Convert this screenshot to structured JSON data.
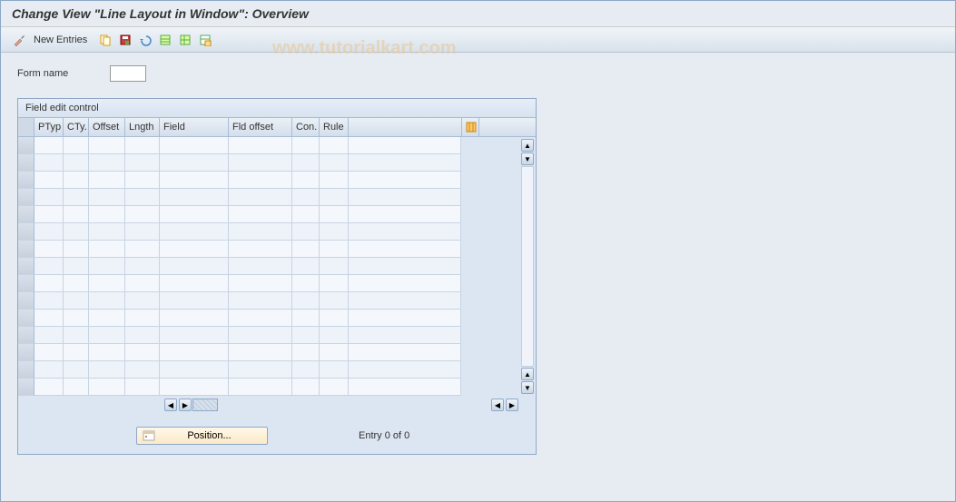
{
  "title": "Change View \"Line Layout in Window\": Overview",
  "toolbar": {
    "new_entries": "New Entries"
  },
  "watermark": "www.tutorialkart.com",
  "form": {
    "name_label": "Form name",
    "name_value": ""
  },
  "panel": {
    "title": "Field edit control",
    "columns": {
      "ptyp": "PTyp",
      "cty": "CTy.",
      "offset": "Offset",
      "lngth": "Lngth",
      "field": "Field",
      "fld_offset": "Fld offset",
      "con": "Con.",
      "rule": "Rule"
    },
    "rows": [
      {},
      {},
      {},
      {},
      {},
      {},
      {},
      {},
      {},
      {},
      {},
      {},
      {},
      {},
      {}
    ],
    "position_btn": "Position...",
    "entry_text": "Entry 0 of 0"
  },
  "icons": {
    "pencil": "pencil-wrench-icon",
    "copy": "copy-icon",
    "save_var": "save-variant-icon",
    "undo": "undo-icon",
    "table_green": "select-all-icon",
    "table2": "table-icon",
    "table_save": "deselect-icon",
    "config": "configure-columns-icon"
  }
}
